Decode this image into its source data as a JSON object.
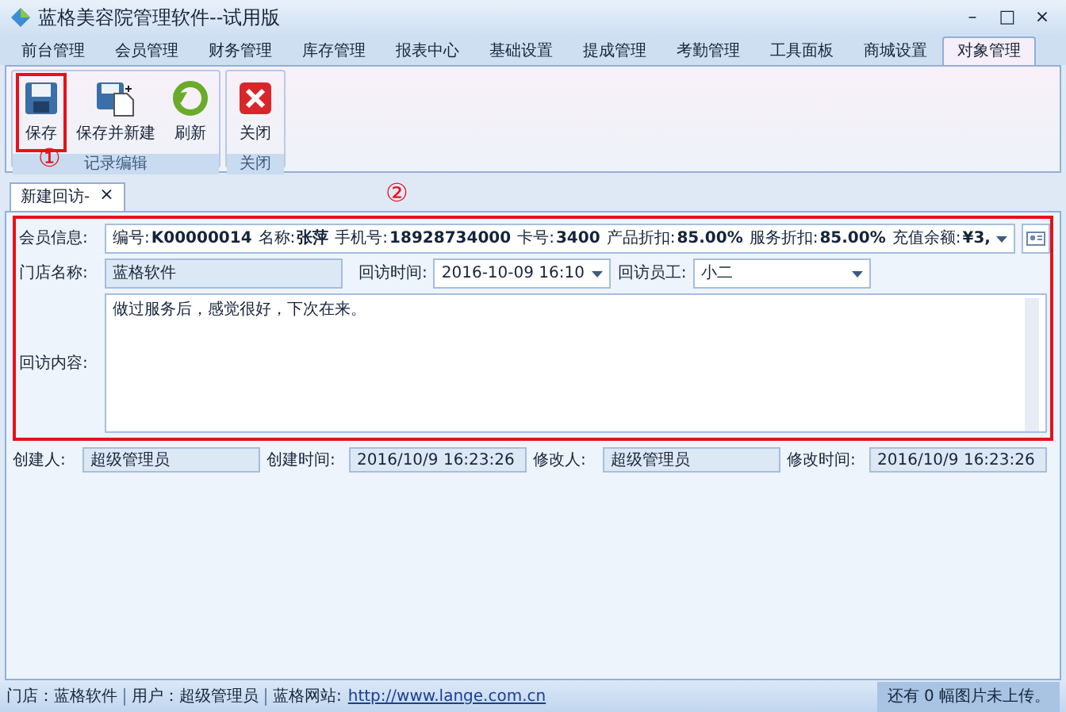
{
  "window": {
    "title": "蓝格美容院管理软件--试用版",
    "controls": [
      "–",
      "□",
      "×"
    ]
  },
  "menu_tabs": [
    {
      "label": "前台管理",
      "selected": false
    },
    {
      "label": "会员管理",
      "selected": false
    },
    {
      "label": "财务管理",
      "selected": false
    },
    {
      "label": "库存管理",
      "selected": false
    },
    {
      "label": "报表中心",
      "selected": false
    },
    {
      "label": "基础设置",
      "selected": false
    },
    {
      "label": "提成管理",
      "selected": false
    },
    {
      "label": "考勤管理",
      "selected": false
    },
    {
      "label": "工具面板",
      "selected": false
    },
    {
      "label": "商城设置",
      "selected": false
    },
    {
      "label": "对象管理",
      "selected": true
    }
  ],
  "ribbon": {
    "groups": [
      {
        "label": "记录编辑",
        "buttons": [
          {
            "label": "保存",
            "kind": "save",
            "annotated": true
          },
          {
            "label": "保存并新建",
            "kind": "save_new",
            "annotated": false
          },
          {
            "label": "刷新",
            "kind": "refresh",
            "annotated": false
          }
        ]
      },
      {
        "label": "关闭",
        "buttons": [
          {
            "label": "关闭",
            "kind": "close",
            "annotated": false
          }
        ]
      }
    ]
  },
  "annotations": [
    "①",
    "②"
  ],
  "doc_tab": {
    "label": "新建回访-",
    "close": "×"
  },
  "form": {
    "annotated": true,
    "member_info": {
      "label": "会员信息:",
      "fields": [
        {
          "label": "编号:",
          "value": "K00000014"
        },
        {
          "label": "名称:",
          "value": "张萍"
        },
        {
          "label": "手机号:",
          "value": "18928734000"
        },
        {
          "label": "卡号:",
          "value": "3400"
        },
        {
          "label": "产品折扣:",
          "value": "85.00%"
        },
        {
          "label": "服务折扣:",
          "value": "85.00%"
        },
        {
          "label": "充值余额:",
          "value": "¥3,"
        }
      ]
    },
    "store": {
      "label": "门店名称:",
      "value": "蓝格软件"
    },
    "visit_time": {
      "label": "回访时间:",
      "value": "2016-10-09 16:10"
    },
    "visit_staff": {
      "label": "回访员工:",
      "value": "小二"
    },
    "content": {
      "label": "回访内容:",
      "value": "做过服务后，感觉很好，下次在来。"
    }
  },
  "audit": [
    {
      "label": "创建人:",
      "value": "超级管理员"
    },
    {
      "label": "创建时间:",
      "value": "2016/10/9 16:23:26"
    },
    {
      "label": "修改人:",
      "value": "超级管理员"
    },
    {
      "label": "修改时间:",
      "value": "2016/10/9 16:23:26"
    }
  ],
  "status_bar": {
    "store": "门店：蓝格软件",
    "user": "用户：超级管理员",
    "site_label": "蓝格网站:",
    "site_link": "http://www.lange.com.cn",
    "upload_note": "还有 0 幅图片未上传。"
  }
}
